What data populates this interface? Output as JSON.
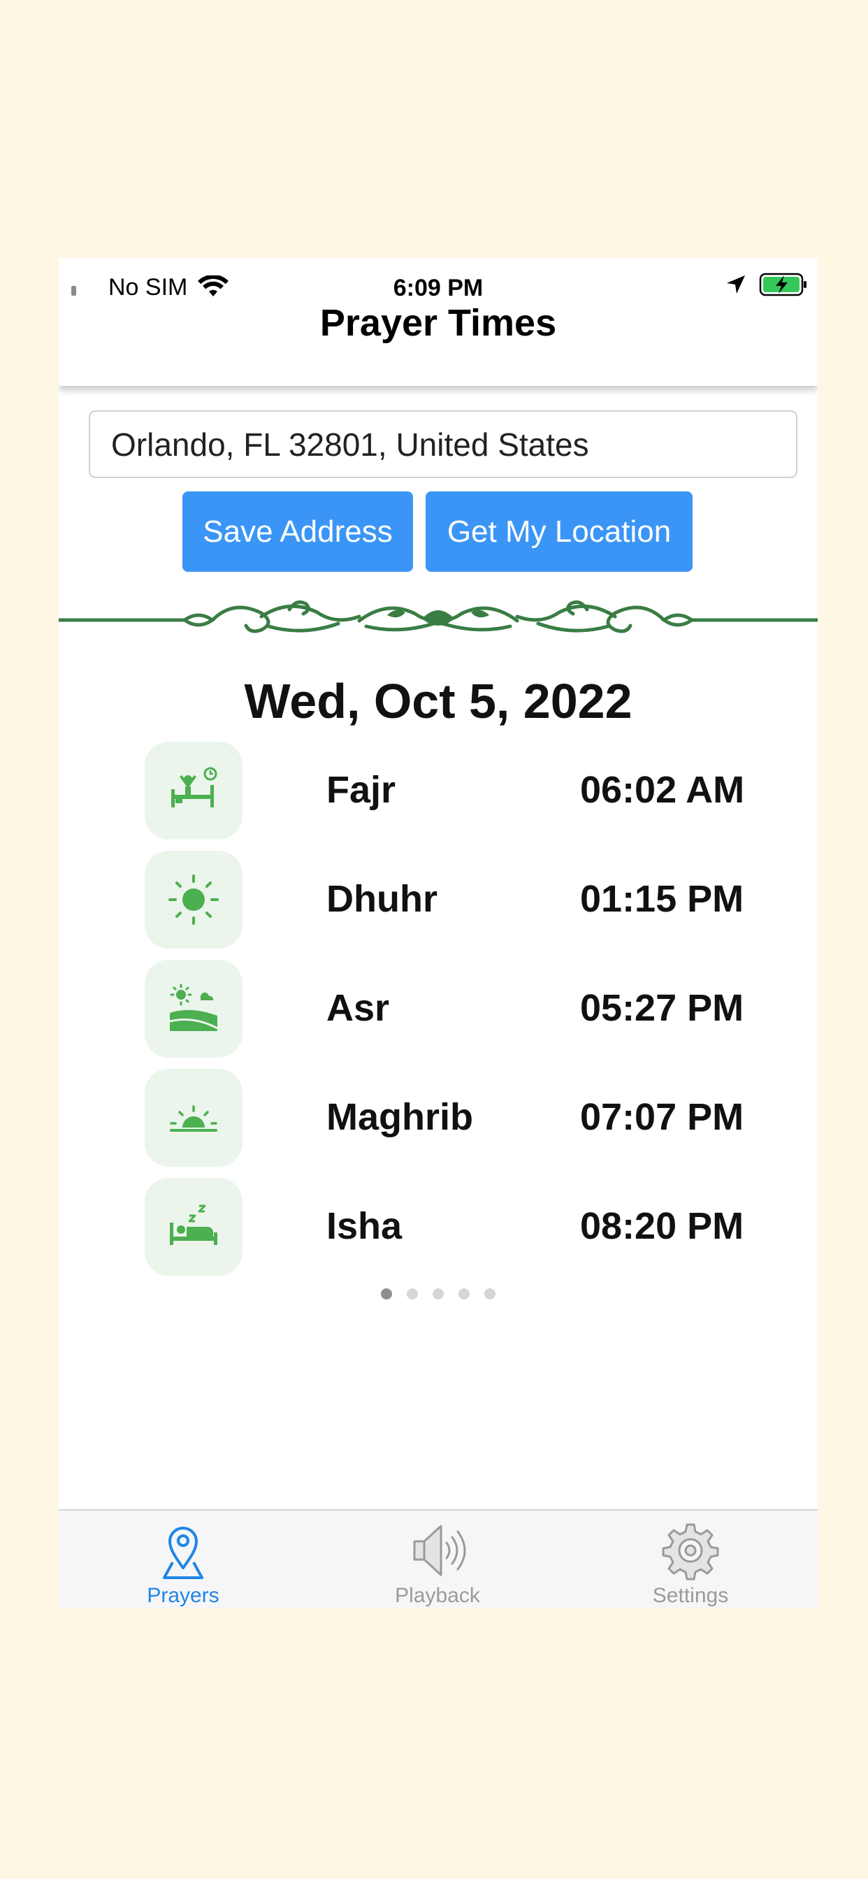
{
  "status_bar": {
    "carrier": "No SIM",
    "time": "6:09 PM",
    "icons": [
      "wifi-icon",
      "location-arrow-icon",
      "battery-charging-icon"
    ]
  },
  "header": {
    "title": "Prayer Times"
  },
  "address": {
    "value": "Orlando, FL 32801, United States"
  },
  "buttons": {
    "save_label": "Save Address",
    "locate_label": "Get My Location",
    "color": "#3b95f6"
  },
  "date": "Wed, Oct 5, 2022",
  "prayers": [
    {
      "name": "Fajr",
      "time": "06:02 AM",
      "icon": "wake-up-icon"
    },
    {
      "name": "Dhuhr",
      "time": "01:15 PM",
      "icon": "sun-icon"
    },
    {
      "name": "Asr",
      "time": "05:27 PM",
      "icon": "landscape-sun-icon"
    },
    {
      "name": "Maghrib",
      "time": "07:07 PM",
      "icon": "sunset-icon"
    },
    {
      "name": "Isha",
      "time": "08:20 PM",
      "icon": "sleep-icon"
    }
  ],
  "pager": {
    "count": 5,
    "active": 0
  },
  "tabs": [
    {
      "label": "Prayers",
      "icon": "map-pin-icon",
      "active": true
    },
    {
      "label": "Playback",
      "icon": "speaker-icon",
      "active": false
    },
    {
      "label": "Settings",
      "icon": "gear-icon",
      "active": false
    }
  ],
  "colors": {
    "background": "#fdf7e4",
    "icon_green": "#4caf50",
    "ornament_green": "#3a7d44",
    "active_tab": "#1f86e5"
  }
}
